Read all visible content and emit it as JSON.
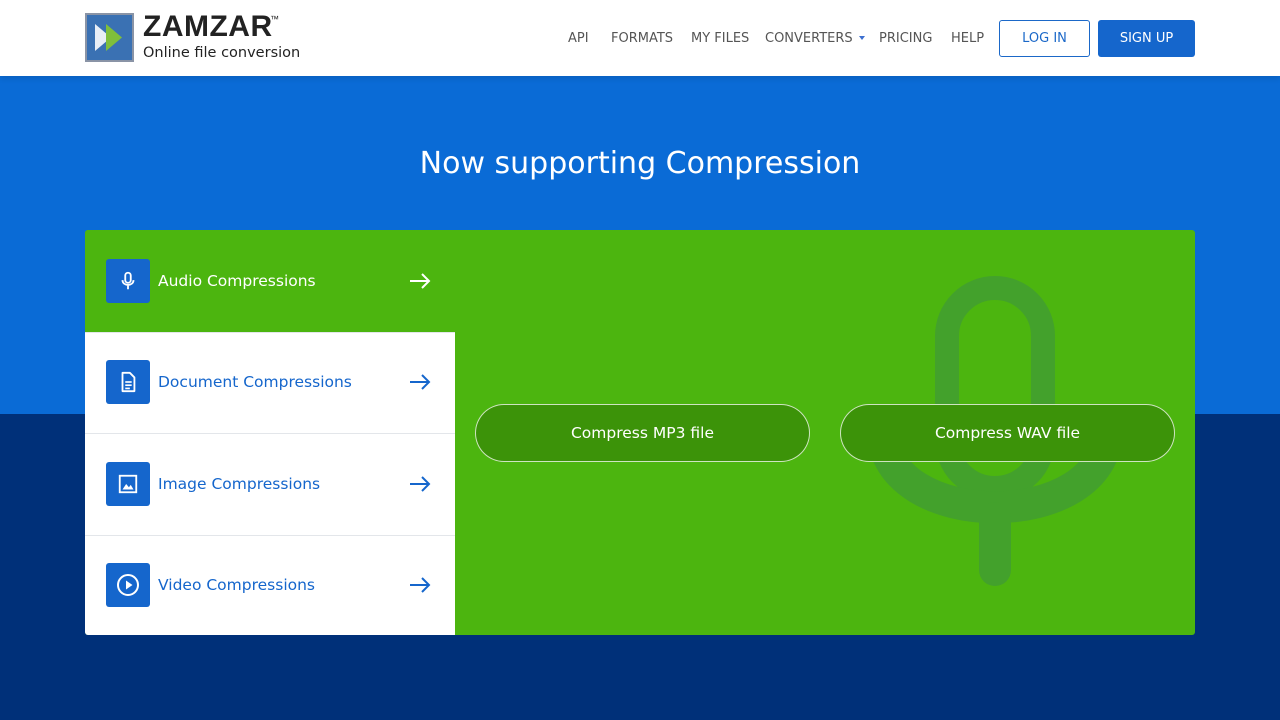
{
  "header": {
    "logo": {
      "name": "ZAMZAR",
      "trademark": "™",
      "tagline": "Online file conversion"
    },
    "nav": [
      {
        "label": "API"
      },
      {
        "label": "FORMATS"
      },
      {
        "label": "MY FILES"
      },
      {
        "label": "CONVERTERS",
        "has_dropdown": true
      },
      {
        "label": "PRICING"
      },
      {
        "label": "HELP"
      }
    ],
    "login_label": "LOG IN",
    "signup_label": "SIGN UP"
  },
  "hero": {
    "title": "Now supporting Compression"
  },
  "compression": {
    "categories": [
      {
        "label": "Audio Compressions",
        "icon": "microphone-icon",
        "active": true
      },
      {
        "label": "Document Compressions",
        "icon": "document-icon",
        "active": false
      },
      {
        "label": "Image Compressions",
        "icon": "image-icon",
        "active": false
      },
      {
        "label": "Video Compressions",
        "icon": "play-icon",
        "active": false
      }
    ],
    "buttons": [
      {
        "label": "Compress MP3 file"
      },
      {
        "label": "Compress WAV file"
      }
    ],
    "background_icon": "microphone-icon"
  },
  "colors": {
    "brand_blue": "#1566cc",
    "hero_blue": "#0a6bd6",
    "dark_navy": "#003079",
    "panel_green": "#4cb50f",
    "button_green": "#3c9309"
  }
}
